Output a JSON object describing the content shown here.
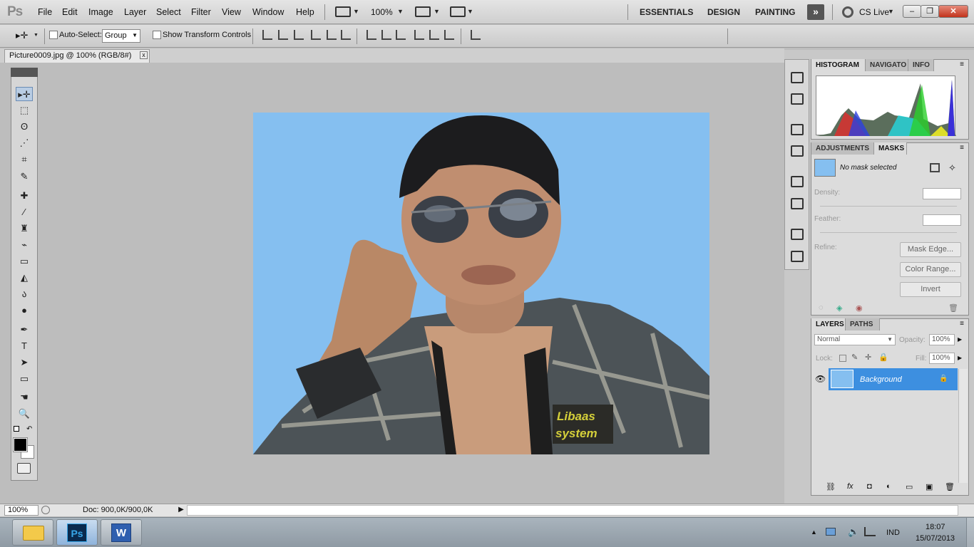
{
  "app": {
    "logo": "Ps"
  },
  "menu": [
    "File",
    "Edit",
    "Image",
    "Layer",
    "Select",
    "Filter",
    "View",
    "Window",
    "Help"
  ],
  "menubar_right": {
    "zoom": "100%",
    "workspaces": [
      "ESSENTIALS",
      "DESIGN",
      "PAINTING"
    ],
    "more": "»",
    "cs_live": "CS Live"
  },
  "window_controls": {
    "minimize": "–",
    "restore": "❐",
    "close": "✕"
  },
  "options": {
    "auto_select_label": "Auto-Select:",
    "auto_select_value": "Group",
    "show_transform_label": "Show Transform Controls"
  },
  "document_tab": {
    "title": "Picture0009.jpg @ 100% (RGB/8#)",
    "close": "x"
  },
  "tools": [
    "▸✛",
    "⬚",
    "ʘ",
    "⋰",
    "⌗",
    "✎",
    "✚",
    "∕",
    "♜",
    "⌁",
    "▭",
    "◭",
    "ა",
    "●",
    "✒",
    "T",
    "➤",
    "▭",
    "☚",
    "🔍"
  ],
  "status": {
    "zoom": "100%",
    "doc": "Doc: 900,0K/900,0K",
    "arrow": "▶"
  },
  "histogram_panel": {
    "tabs": [
      "HISTOGRAM",
      "NAVIGATO",
      "INFO"
    ],
    "active": 0
  },
  "masks_panel": {
    "tabs": [
      "ADJUSTMENTS",
      "MASKS"
    ],
    "active": 1,
    "no_mask": "No mask selected",
    "density_label": "Density:",
    "feather_label": "Feather:",
    "refine_label": "Refine:",
    "buttons": [
      "Mask Edge...",
      "Color Range...",
      "Invert"
    ]
  },
  "layers_panel": {
    "tabs": [
      "LAYERS",
      "PATHS"
    ],
    "active": 0,
    "blend_mode": "Normal",
    "opacity_label": "Opacity:",
    "opacity": "100%",
    "lock_label": "Lock:",
    "fill_label": "Fill:",
    "fill": "100%",
    "layer_name": "Background",
    "footer_icons": [
      "⛓",
      "fx",
      "◘",
      "◐",
      "▭",
      "▣",
      "🗑"
    ]
  },
  "taskbar": {
    "time": "18:07",
    "date": "15/07/2013",
    "lang": "IND",
    "apps": [
      "Explorer",
      "Ps",
      "W"
    ]
  },
  "photo_text": "Libaas system",
  "colors": {
    "photo_bg": "#85bff0",
    "selection": "#3d8fe0",
    "accent": "#c2331c"
  }
}
